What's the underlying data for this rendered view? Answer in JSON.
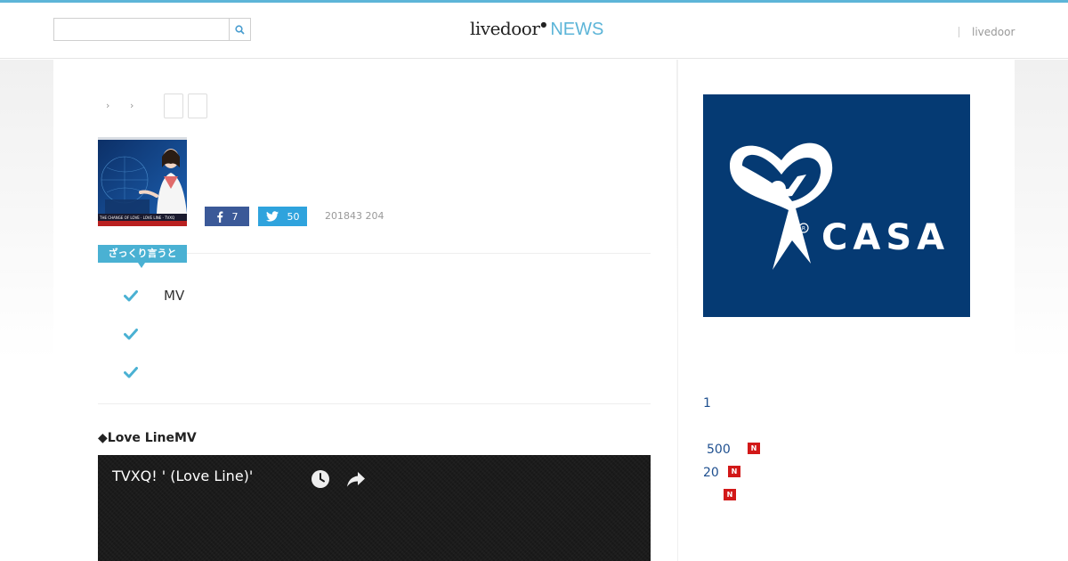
{
  "header": {
    "search": {
      "value": "",
      "placeholder": ""
    },
    "logo": {
      "brand": "livedoor",
      "news": "NEWS"
    },
    "link_label": "livedoor"
  },
  "article": {
    "share": {
      "facebook_count": "7",
      "twitter_count": "50"
    },
    "date": "201843 204",
    "summary": {
      "tag": "ざっくり言うと",
      "items": [
        "MV",
        "",
        ""
      ]
    },
    "section_heading": "◆Love LineMV",
    "video": {
      "title": "TVXQ!        '      (Love Line)'"
    }
  },
  "sidebar": {
    "ad": {
      "brand": "CASA"
    },
    "ranking": [
      {
        "label": "1",
        "new": false
      },
      {
        "label": "500",
        "new": true
      },
      {
        "label": "20",
        "new": true
      },
      {
        "label": "",
        "new": true
      }
    ],
    "new_badge_label": "N"
  },
  "colors": {
    "accent": "#5db5d8",
    "facebook": "#3b5998",
    "twitter": "#2fa3dd",
    "summary_tag": "#4ab1d3",
    "ad_bg": "#053a73",
    "new_badge": "#d21818",
    "rank_text": "#1e4f8f"
  },
  "icons": {
    "search": "search-icon",
    "facebook": "facebook-icon",
    "twitter": "twitter-icon",
    "check": "check-icon",
    "watch_later": "clock-icon",
    "share": "share-icon"
  }
}
